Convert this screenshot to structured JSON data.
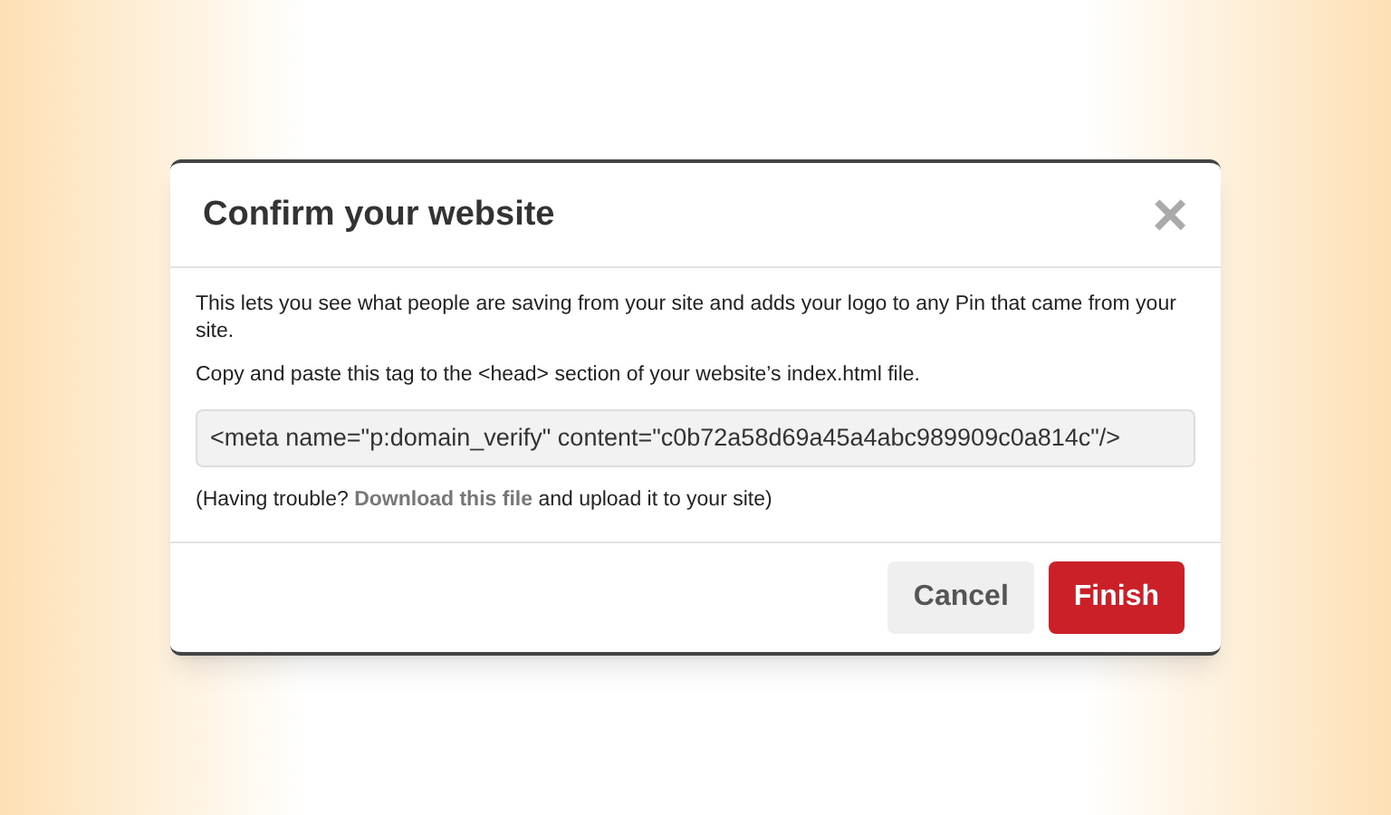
{
  "dialog": {
    "title": "Confirm your website",
    "close": "×",
    "description": "This lets you see what people are saving from your site and adds your logo to any Pin that came from your site.",
    "instruction": "Copy and paste this tag to the <head> section of your website’s index.html file.",
    "meta_tag": "<meta name=\"p:domain_verify\" content=\"c0b72a58d69a45a4abc989909c0a814c\"/>",
    "help": {
      "before": "(Having trouble?",
      "link": "Download this file",
      "after": "and upload it to your site)"
    },
    "buttons": [
      {
        "label": "Cancel",
        "kind": "secondary"
      },
      {
        "label": "Finish",
        "kind": "primary"
      }
    ]
  }
}
